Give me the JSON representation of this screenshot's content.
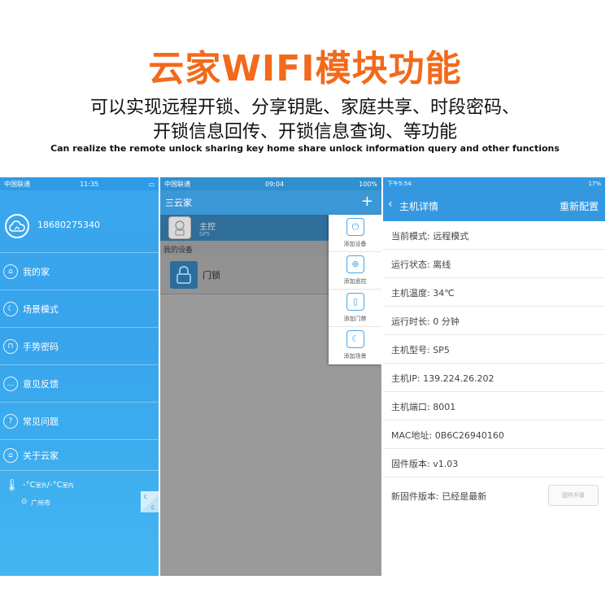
{
  "header": {
    "title": "云家WIFI模块功能",
    "line1": "可以实现远程开锁、分享钥匙、家庭共享、时段密码、",
    "line2": "开锁信息回传、开锁信息查询、等功能",
    "english": "Can realize the remote unlock sharing key home share unlock information query and other functions"
  },
  "screen_menu": {
    "status": {
      "carrier": "中国联通",
      "time": "11:35"
    },
    "profile": {
      "phone": "18680275340",
      "icon": "cloud-home-icon"
    },
    "items": [
      {
        "label": "我的家",
        "icon": "home-icon"
      },
      {
        "label": "场景模式",
        "icon": "moon-icon"
      },
      {
        "label": "手势密码",
        "icon": "lock-icon"
      },
      {
        "label": "意见反馈",
        "icon": "chat-icon"
      },
      {
        "label": "常见问题",
        "icon": "question-icon"
      },
      {
        "label": "关于云家",
        "icon": "house-icon"
      }
    ],
    "weather": {
      "outdoor": "-°C",
      "outdoor_label": "室外",
      "sep": "/",
      "indoor": "-°C",
      "indoor_label": "室内",
      "city": "广州市"
    }
  },
  "screen_devices": {
    "status": {
      "carrier": "中国联通",
      "time": "09:04",
      "battery": "100%"
    },
    "nav_title": "三云家",
    "master": {
      "name": "主控",
      "model": "SP5"
    },
    "section_label": "我的设备",
    "lock_name": "门锁",
    "popup": [
      {
        "label": "添加设备",
        "icon": "power-icon"
      },
      {
        "label": "添加遥控",
        "icon": "remote-icon"
      },
      {
        "label": "添加门禁",
        "icon": "door-icon"
      },
      {
        "label": "添加场景",
        "icon": "moon-icon"
      }
    ]
  },
  "screen_details": {
    "status": {
      "time": "下午5:54",
      "battery": "17%"
    },
    "nav_title": "主机详情",
    "nav_action": "重新配置",
    "rows": [
      "当前模式: 远程模式",
      "运行状态: 离线",
      "主机温度: 34℃",
      "运行时长: 0 分钟",
      "主机型号:  SP5",
      "主机IP: 139.224.26.202",
      "主机端口: 8001",
      "MAC地址: 0B6C26940160",
      "固件版本: v1.03",
      "新固件版本: 已经是最新"
    ],
    "upgrade_button": "固件升级"
  },
  "colors": {
    "title_orange": "#f26a1b",
    "app_blue": "#3498e0"
  }
}
